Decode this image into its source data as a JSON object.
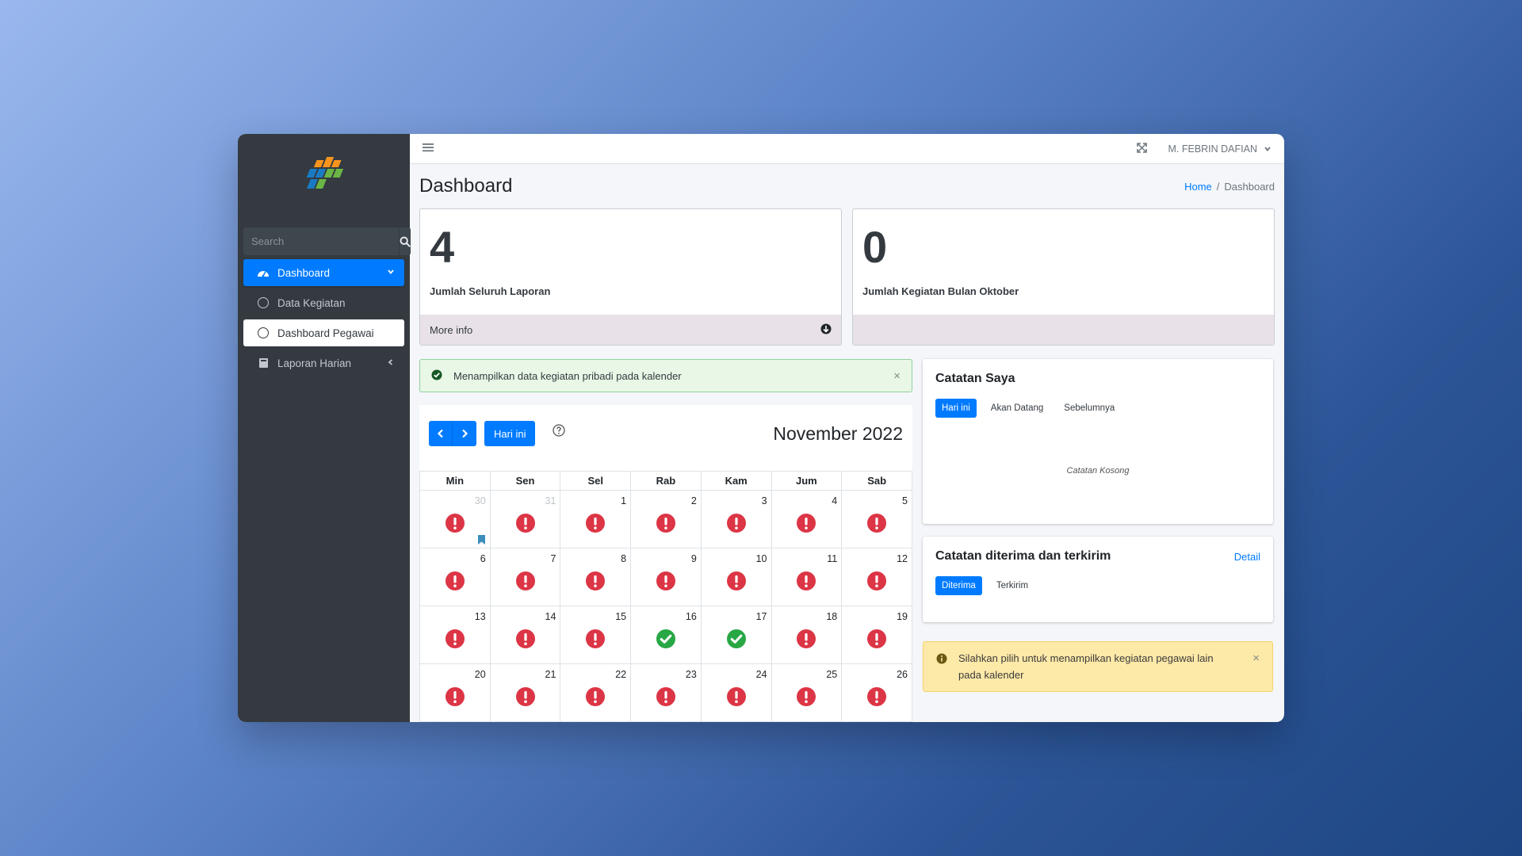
{
  "colors": {
    "primary": "#007bff",
    "danger": "#dc3545",
    "success": "#28a745",
    "sidebar": "#343a40"
  },
  "sidebar": {
    "logo_icon": "bps-logo",
    "search_placeholder": "Search",
    "items": [
      {
        "label": "Dashboard",
        "icon": "tachometer-icon",
        "state": "active"
      },
      {
        "label": "Data Kegiatan",
        "icon": "circle-icon",
        "state": ""
      },
      {
        "label": "Dashboard Pegawai",
        "icon": "circle-icon",
        "state": "selected"
      },
      {
        "label": "Laporan Harian",
        "icon": "book-icon",
        "state": ""
      }
    ]
  },
  "topbar": {
    "user_name": "M. FEBRIN DAFIAN"
  },
  "page": {
    "title": "Dashboard",
    "breadcrumb": {
      "home": "Home",
      "sep": "/",
      "current": "Dashboard"
    }
  },
  "stats": [
    {
      "value": "4",
      "label": "Jumlah Seluruh Laporan",
      "footer": "More info"
    },
    {
      "value": "0",
      "label": "Jumlah Kegiatan Bulan Oktober",
      "footer": ""
    }
  ],
  "alert_success": {
    "text": "Menampilkan data kegiatan pribadi pada kalender",
    "close": "×"
  },
  "calendar": {
    "today_label": "Hari ini",
    "title": "November 2022",
    "weekdays": [
      "Min",
      "Sen",
      "Sel",
      "Rab",
      "Kam",
      "Jum",
      "Sab"
    ],
    "weeks": [
      [
        {
          "d": "30",
          "other": true,
          "s": "x",
          "bookmark": true
        },
        {
          "d": "31",
          "other": true,
          "s": "x"
        },
        {
          "d": "1",
          "s": "x"
        },
        {
          "d": "2",
          "s": "x"
        },
        {
          "d": "3",
          "s": "x"
        },
        {
          "d": "4",
          "s": "x"
        },
        {
          "d": "5",
          "s": "x"
        }
      ],
      [
        {
          "d": "6",
          "s": "x"
        },
        {
          "d": "7",
          "s": "x"
        },
        {
          "d": "8",
          "s": "x"
        },
        {
          "d": "9",
          "s": "x"
        },
        {
          "d": "10",
          "s": "x"
        },
        {
          "d": "11",
          "s": "x"
        },
        {
          "d": "12",
          "s": "x"
        }
      ],
      [
        {
          "d": "13",
          "s": "x"
        },
        {
          "d": "14",
          "s": "x"
        },
        {
          "d": "15",
          "s": "x"
        },
        {
          "d": "16",
          "s": "ok"
        },
        {
          "d": "17",
          "s": "ok"
        },
        {
          "d": "18",
          "s": "x"
        },
        {
          "d": "19",
          "s": "x"
        }
      ],
      [
        {
          "d": "20",
          "s": "x"
        },
        {
          "d": "21",
          "s": "x"
        },
        {
          "d": "22",
          "s": "x"
        },
        {
          "d": "23",
          "s": "x"
        },
        {
          "d": "24",
          "s": "x"
        },
        {
          "d": "25",
          "s": "x"
        },
        {
          "d": "26",
          "s": "x"
        }
      ]
    ]
  },
  "notes": {
    "title": "Catatan Saya",
    "tabs": [
      "Hari ini",
      "Akan Datang",
      "Sebelumnya"
    ],
    "empty": "Catatan Kosong"
  },
  "received": {
    "title": "Catatan diterima dan terkirim",
    "detail": "Detail",
    "tabs": [
      "Diterima",
      "Terkirim"
    ]
  },
  "alert_warning": {
    "text": "Silahkan pilih untuk menampilkan kegiatan pegawai lain pada kalender",
    "close": "×"
  }
}
